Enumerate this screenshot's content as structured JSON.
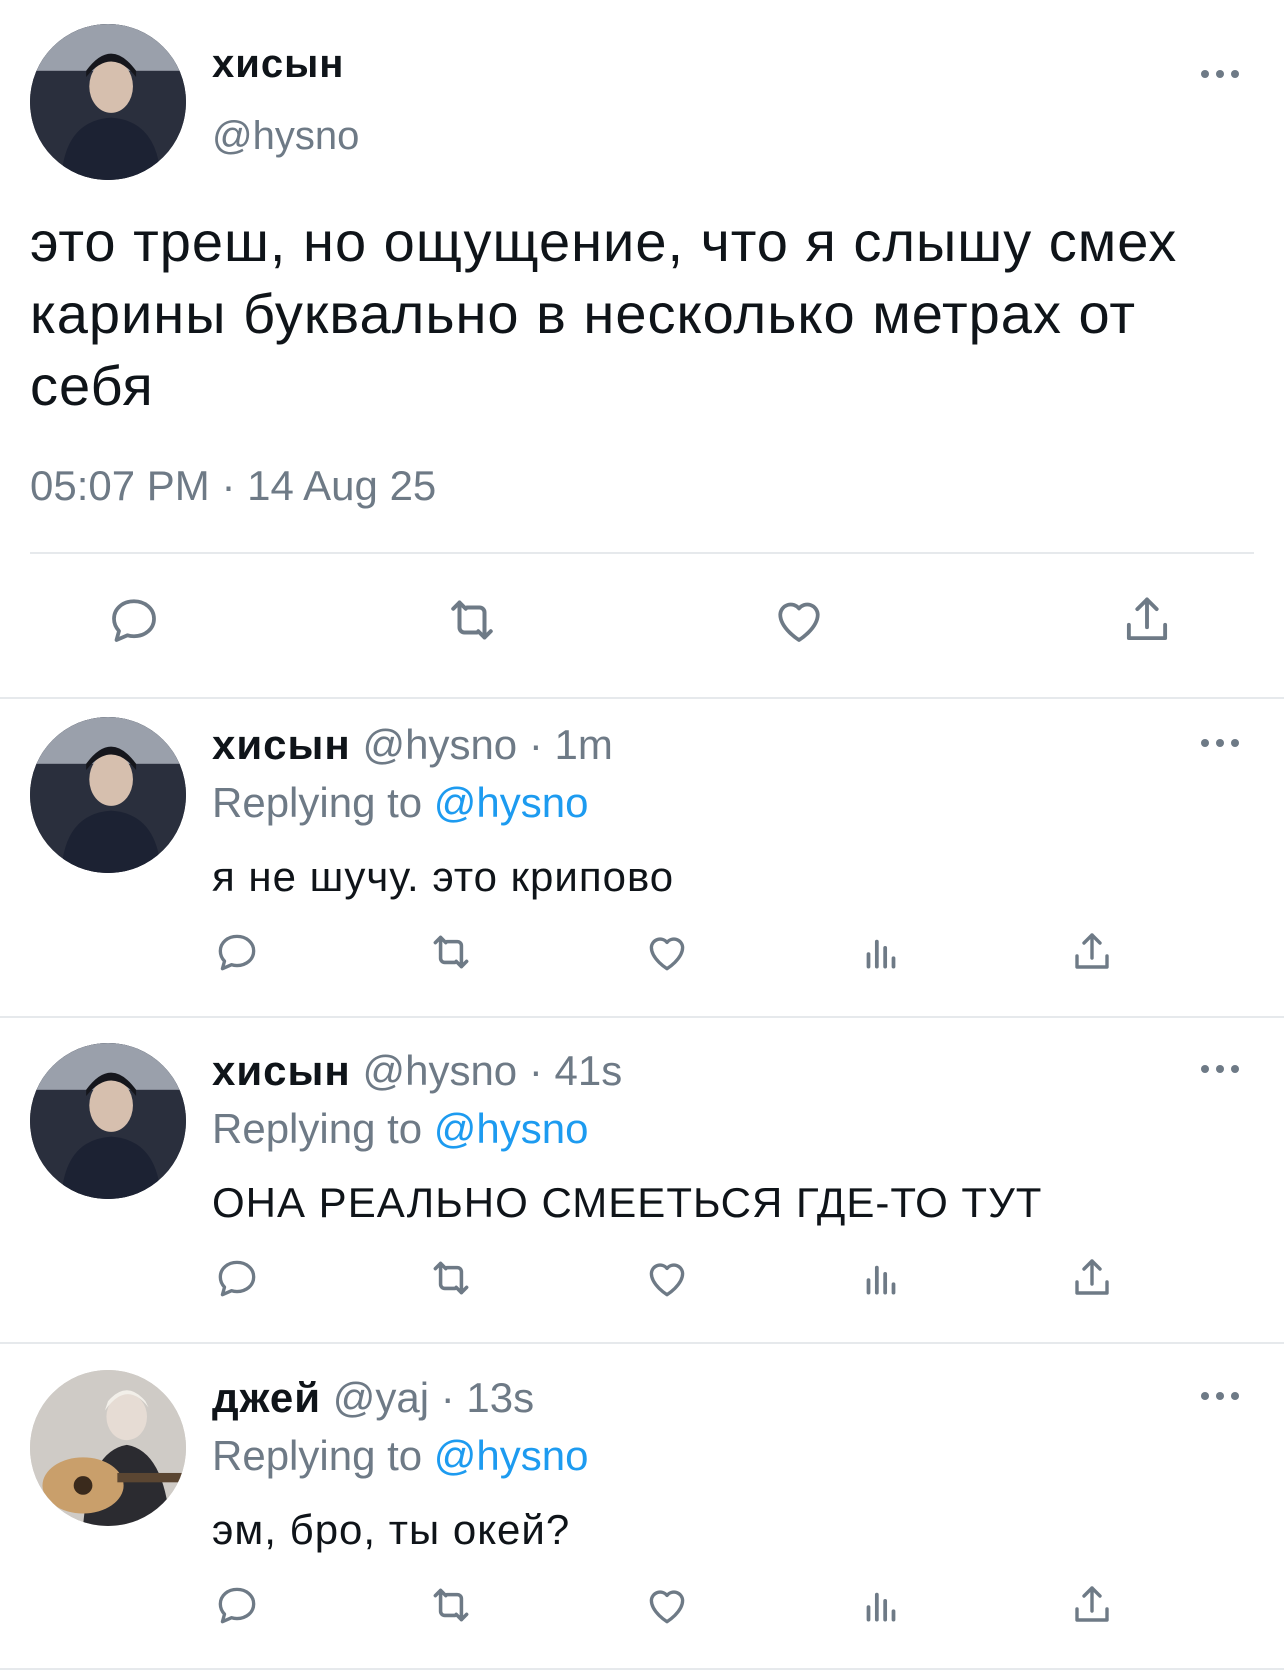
{
  "main_tweet": {
    "display_name": "хисын",
    "handle": "@hysno",
    "text": "это треш, но ощущение, что я слышу смех карины буквально в несколько метрах от себя",
    "timestamp": "05:07 PM · 14 Aug 25",
    "avatar_icon": "profile-photo",
    "actions": [
      "reply-icon",
      "retweet-icon",
      "like-icon",
      "share-icon"
    ]
  },
  "replies": [
    {
      "display_name": "хисын",
      "handle_time": "@hysno · 1m",
      "replying_label": "Replying to",
      "replying_mention": "@hysno",
      "text": "я не шучу. это крипово"
    },
    {
      "display_name": "хисын",
      "handle_time": "@hysno · 41s",
      "replying_label": "Replying to",
      "replying_mention": "@hysno",
      "text": "ОНА РЕАЛЬНО СМЕЕТЬСЯ ГДЕ-ТО ТУТ"
    },
    {
      "display_name": "джей",
      "handle_time": "@yaj · 13s",
      "replying_label": "Replying to",
      "replying_mention": "@hysno",
      "text": "эм, бро, ты окей?"
    }
  ],
  "reply_actions": [
    "reply-icon",
    "retweet-icon",
    "like-icon",
    "views-icon",
    "share-icon"
  ],
  "colors": {
    "text": "#0f1419",
    "secondary": "#6e7a86",
    "link": "#1d9bf0",
    "divider": "#e6e9ec"
  }
}
